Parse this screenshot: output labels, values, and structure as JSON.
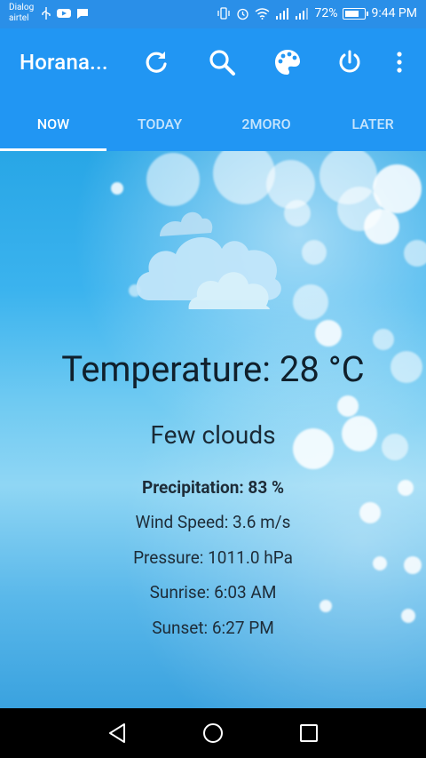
{
  "status_bar": {
    "carrier_line1": "Dialog",
    "carrier_line2": "airtel",
    "battery": "72%",
    "time": "9:44 PM"
  },
  "toolbar": {
    "title": "Horana...",
    "icons": [
      "refresh-icon",
      "search-icon",
      "palette-icon",
      "power-icon",
      "more-vert-icon"
    ]
  },
  "tabs": [
    {
      "label": "NOW",
      "active": true
    },
    {
      "label": "TODAY",
      "active": false
    },
    {
      "label": "2MORO",
      "active": false
    },
    {
      "label": "LATER",
      "active": false
    }
  ],
  "weather": {
    "icon": "few-clouds-icon",
    "temperature": "Temperature: 28 °C",
    "conditions": "Few clouds",
    "precipitation": "Precipitation: 83 %",
    "wind_speed": "Wind Speed: 3.6 m/s",
    "pressure": "Pressure: 1011.0 hPa",
    "sunrise": "Sunrise: 6:03 AM",
    "sunset": "Sunset: 6:27 PM"
  },
  "nav_bar": {
    "buttons": [
      "back-icon",
      "home-icon",
      "recents-icon"
    ]
  },
  "colors": {
    "primary": "#2196f3",
    "status_bar": "#2a8fe8"
  }
}
